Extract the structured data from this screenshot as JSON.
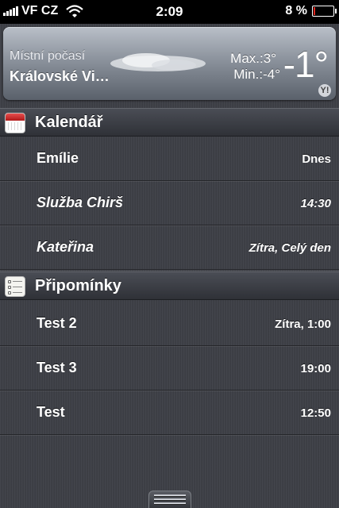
{
  "status_bar": {
    "carrier": "VF CZ",
    "time": "2:09",
    "battery_text": "8 %",
    "battery_level": 0.08,
    "signal_icon": "signal-bars-icon",
    "wifi_icon": "wifi-icon",
    "battery_icon": "battery-icon",
    "battery_color": "#e0261f"
  },
  "weather": {
    "label": "Místní počasí",
    "city": "Královské Vi…",
    "max": "Max.:3°",
    "min": "Min.:-4°",
    "temp": "-1°",
    "cloud_icon": "cloud-icon",
    "yahoo_icon": "yahoo-icon",
    "yahoo_mark": "Y!"
  },
  "calendar": {
    "title": "Kalendář",
    "icon": "calendar-icon",
    "items": [
      {
        "title": "Emílie",
        "meta": "Dnes"
      },
      {
        "title": "Služba Chirš",
        "meta": "14:30"
      },
      {
        "title": "Kateřina",
        "meta": "Zítra, Celý den"
      }
    ]
  },
  "reminders": {
    "title": "Připomínky",
    "icon": "reminders-icon",
    "items": [
      {
        "title": "Test 2",
        "meta": "Zítra, 1:00"
      },
      {
        "title": "Test 3",
        "meta": "19:00"
      },
      {
        "title": "Test",
        "meta": "12:50"
      }
    ]
  },
  "handle": {
    "icon": "drag-handle-icon"
  }
}
